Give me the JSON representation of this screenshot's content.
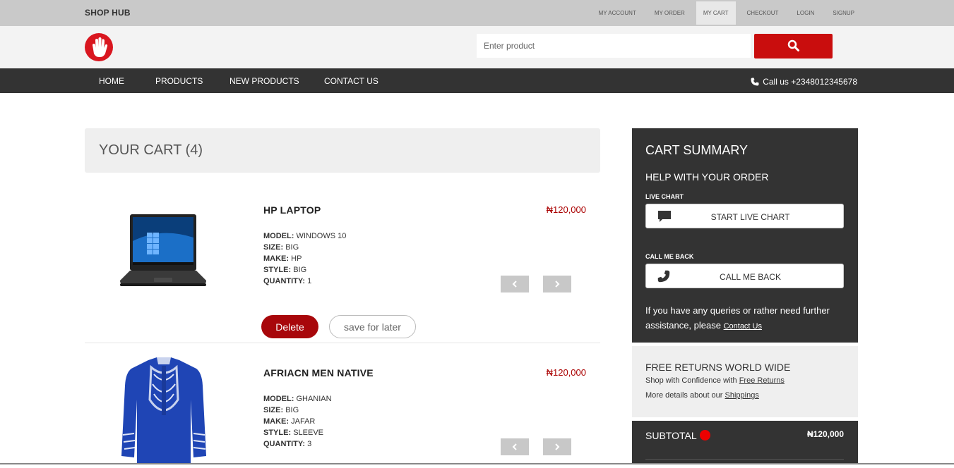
{
  "topbar": {
    "brand": "SHOP HUB",
    "links": [
      "MY ACCOUNT",
      "MY ORDER",
      "MY CART",
      "CHECKOUT",
      "LOGIN",
      "SIGNUP"
    ],
    "active": "MY CART"
  },
  "header": {
    "search_placeholder": "Enter product",
    "accent_color": "#c90d0d"
  },
  "nav": {
    "items": [
      "HOME",
      "PRODUCTS",
      "NEW PRODUCTS",
      "CONTACT US"
    ],
    "call_text": "Call us +2348012345678"
  },
  "cart": {
    "title": "YOUR CART (4)",
    "items": [
      {
        "name": "HP LAPTOP",
        "price": "₦120,000",
        "specs": [
          {
            "label": "MODEL:",
            "value": "WINDOWS 10"
          },
          {
            "label": "SIZE:",
            "value": "BIG"
          },
          {
            "label": "MAKE:",
            "value": "HP"
          },
          {
            "label": "STYLE:",
            "value": "BIG"
          },
          {
            "label": "QUANTITY:",
            "value": "1"
          }
        ],
        "delete_label": "Delete",
        "save_label": "save for later"
      },
      {
        "name": "AFRIACN MEN NATIVE",
        "price": "₦120,000",
        "specs": [
          {
            "label": "MODEL:",
            "value": "GHANIAN"
          },
          {
            "label": "SIZE:",
            "value": "BIG"
          },
          {
            "label": "MAKE:",
            "value": "JAFAR"
          },
          {
            "label": "STYLE:",
            "value": "SLEEVE"
          },
          {
            "label": "QUANTITY:",
            "value": "3"
          }
        ]
      }
    ]
  },
  "summary": {
    "title": "CART SUMMARY",
    "help": "HELP WITH YOUR ORDER",
    "live_chat_label": "LIVE CHART",
    "live_chat_button": "START LIVE CHART",
    "call_back_label": "CALL ME BACK",
    "call_back_button": "CALL ME BACK",
    "note_text": "If you have any queries or rather need further assistance, please",
    "note_link": "Contact Us"
  },
  "returns": {
    "title": "FREE RETURNS WORLD WIDE",
    "line1_text": "Shop with Confidence with",
    "line1_link": "Free Returns",
    "line2_text": "More details about our",
    "line2_link": "Shippings"
  },
  "subtotal": {
    "label": "SUBTOTAL",
    "value": "₦120,000"
  }
}
